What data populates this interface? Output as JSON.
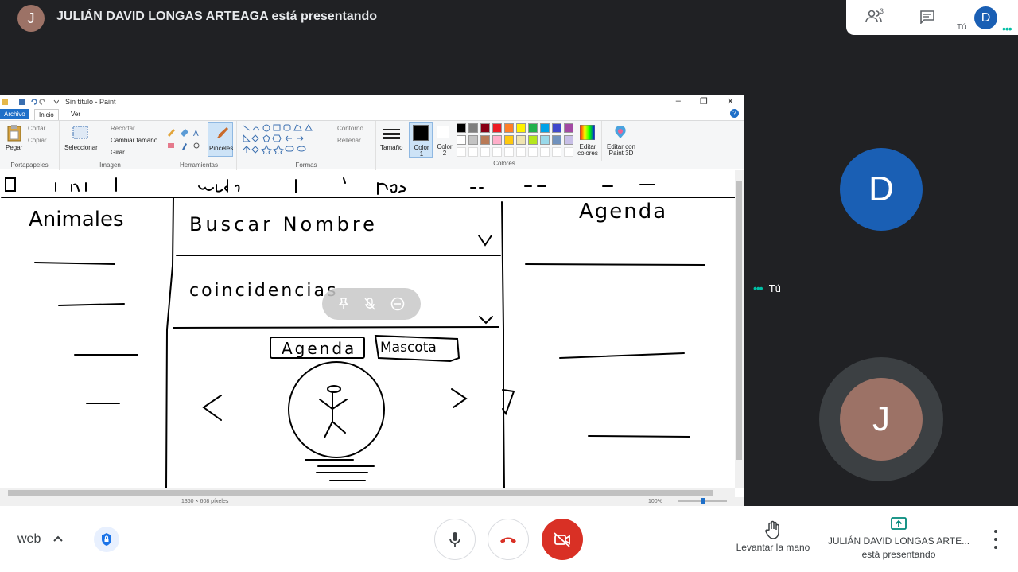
{
  "header": {
    "presenter_initial": "J",
    "presenter_text": "JULIÁN DAVID LONGAS ARTEAGA está presentando",
    "participants_count": "3",
    "self_initial": "D",
    "self_label": "Tú"
  },
  "paint": {
    "window_title": "Sin título - Paint",
    "tabs": [
      "Archivo",
      "Inicio",
      "Ver"
    ],
    "ribbon": {
      "clipboard": {
        "paste": "Pegar",
        "cut": "Cortar",
        "copy": "Copiar",
        "label": "Portapapeles"
      },
      "image": {
        "select": "Seleccionar",
        "crop": "Recortar",
        "resize": "Cambiar tamaño",
        "rotate": "Girar",
        "label": "Imagen"
      },
      "tools": {
        "brushes": "Pinceles",
        "label": "Herramientas"
      },
      "shapes": {
        "outline": "Contorno",
        "fill": "Rellenar",
        "label": "Formas"
      },
      "size": "Tamaño",
      "color1": "Color 1",
      "color2": "Color 2",
      "colors_label": "Colores",
      "edit_colors": "Editar colores",
      "edit_3d": "Editar con Paint 3D"
    },
    "palette_row1": [
      "#000000",
      "#7f7f7f",
      "#880015",
      "#ed1c24",
      "#ff7f27",
      "#fff200",
      "#22b14c",
      "#00a2e8",
      "#3f48cc",
      "#a349a4"
    ],
    "palette_row2": [
      "#ffffff",
      "#c3c3c3",
      "#b97a57",
      "#ffaec9",
      "#ffc90e",
      "#efe4b0",
      "#b5e61d",
      "#99d9ea",
      "#7092be",
      "#c8bfe7"
    ],
    "status": {
      "dimensions": "1360 × 608 píxeles",
      "zoom": "100%"
    }
  },
  "sketch": {
    "left_heading": "Animales",
    "center_search": "Buscar Nombre",
    "center_coincidencias": "coincidencias",
    "btn_agenda": "Agenda",
    "btn_mascota": "Mascota",
    "right_heading": "Agenda"
  },
  "participants": {
    "d_initial": "D",
    "tu_label": "Tú",
    "j_initial": "J"
  },
  "bottom": {
    "meeting_code": "web",
    "raise_hand": "Levantar la mano",
    "presenting_name": "JULIÁN DAVID LONGAS ARTE...",
    "presenting_status": "está presentando"
  }
}
